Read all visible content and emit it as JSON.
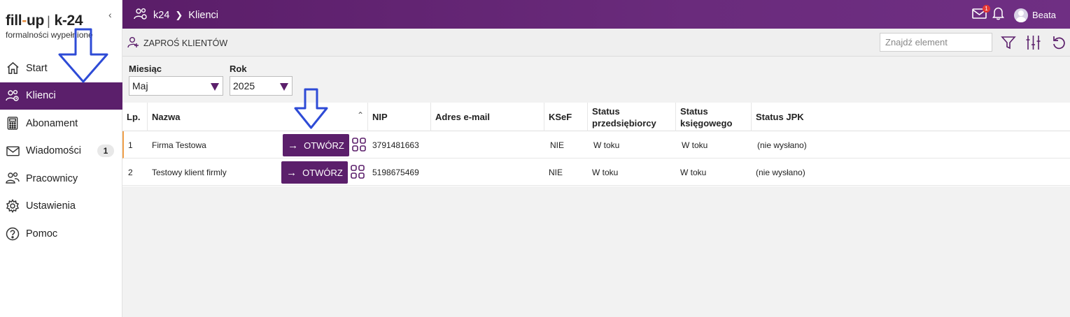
{
  "logo": {
    "fill": "fill",
    "dash": "-",
    "up": "up",
    "k24": "k-24",
    "subtitle": "formalności wypełnione"
  },
  "sidebar": {
    "collapse_icon": "chevron-left-icon",
    "items": [
      {
        "label": "Start",
        "icon": "home-icon"
      },
      {
        "label": "Klienci",
        "icon": "clients-icon",
        "active": true
      },
      {
        "label": "Abonament",
        "icon": "calculator-icon"
      },
      {
        "label": "Wiadomości",
        "icon": "mail-icon",
        "badge": "1"
      },
      {
        "label": "Pracownicy",
        "icon": "employees-icon"
      },
      {
        "label": "Ustawienia",
        "icon": "gear-icon"
      },
      {
        "label": "Pomoc",
        "icon": "help-icon"
      }
    ]
  },
  "header": {
    "breadcrumb": [
      "k24",
      "Klienci"
    ],
    "mail_badge": "1",
    "user_name": "Beata",
    "colors": {
      "primary": "#5b1f6b",
      "accent": "#f0a04b"
    }
  },
  "toolbar": {
    "invite_label": "ZAPROŚ KLIENTÓW",
    "search_placeholder": "Znajdź element",
    "icons": [
      "filter-icon",
      "columns-icon",
      "refresh-icon"
    ]
  },
  "filters": {
    "month": {
      "label": "Miesiąc",
      "value": "Maj"
    },
    "year": {
      "label": "Rok",
      "value": "2025"
    }
  },
  "table": {
    "columns": [
      "Lp.",
      "Nazwa",
      "NIP",
      "Adres e-mail",
      "KSeF",
      "Status przedsiębiorcy",
      "Status księgowego",
      "Status JPK"
    ],
    "open_label": "OTWÓRZ",
    "rows": [
      {
        "lp": "1",
        "name": "Firma Testowa",
        "nip": "3791481663",
        "email": "",
        "ksef": "NIE",
        "status_p": "W toku",
        "status_k": "W toku",
        "status_jpk": "(nie wysłano)"
      },
      {
        "lp": "2",
        "name": "Testowy klient firmly",
        "nip": "5198675469",
        "email": "",
        "ksef": "NIE",
        "status_p": "W toku",
        "status_k": "W toku",
        "status_jpk": "(nie wysłano)"
      }
    ]
  }
}
